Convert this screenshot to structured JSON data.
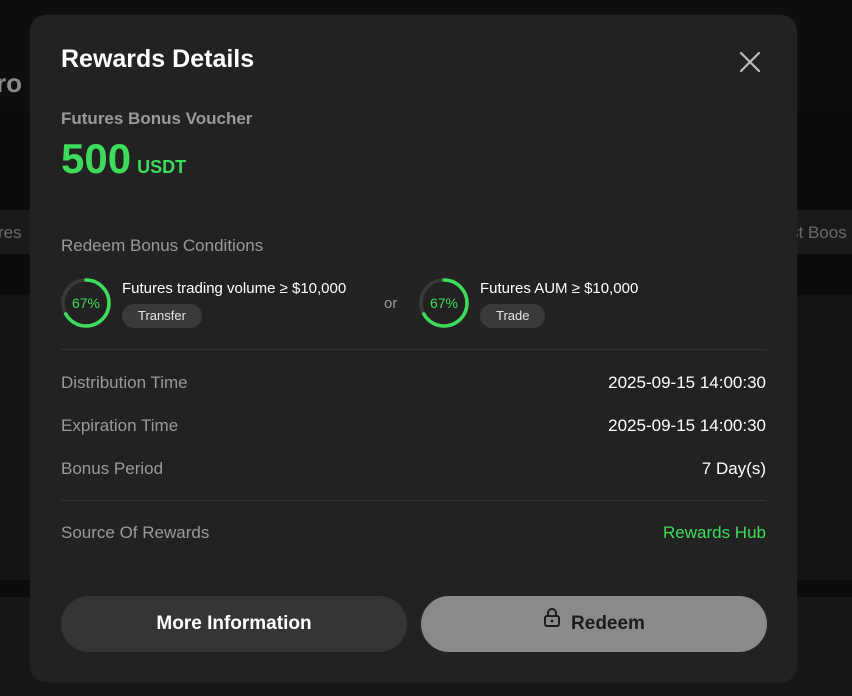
{
  "background": {
    "title_fragment": "ro",
    "tab_fragment_left": "res",
    "tab_fragment_right": "st Boos"
  },
  "modal": {
    "title": "Rewards Details",
    "close_icon": "close-icon",
    "voucher": {
      "name": "Futures Bonus Voucher",
      "amount": "500",
      "unit": "USDT"
    },
    "conditions": {
      "label": "Redeem Bonus Conditions",
      "separator": "or",
      "items": [
        {
          "progress_text": "67%",
          "progress_fraction": 0.67,
          "text": "Futures trading volume ≥ $10,000",
          "action": "Transfer"
        },
        {
          "progress_text": "67%",
          "progress_fraction": 0.67,
          "text": "Futures AUM ≥ $10,000",
          "action": "Trade"
        }
      ]
    },
    "details": [
      {
        "label": "Distribution Time",
        "value": "2025-09-15 14:00:30"
      },
      {
        "label": "Expiration Time",
        "value": "2025-09-15 14:00:30"
      },
      {
        "label": "Bonus Period",
        "value": "7 Day(s)"
      }
    ],
    "source": {
      "label": "Source Of Rewards",
      "value": "Rewards Hub"
    },
    "buttons": {
      "more_info": "More Information",
      "redeem": "Redeem",
      "redeem_icon": "lock-icon"
    }
  },
  "colors": {
    "accent_green": "#3ddc5a",
    "modal_bg": "#222222",
    "redeem_disabled_bg": "#8a8a8a"
  }
}
